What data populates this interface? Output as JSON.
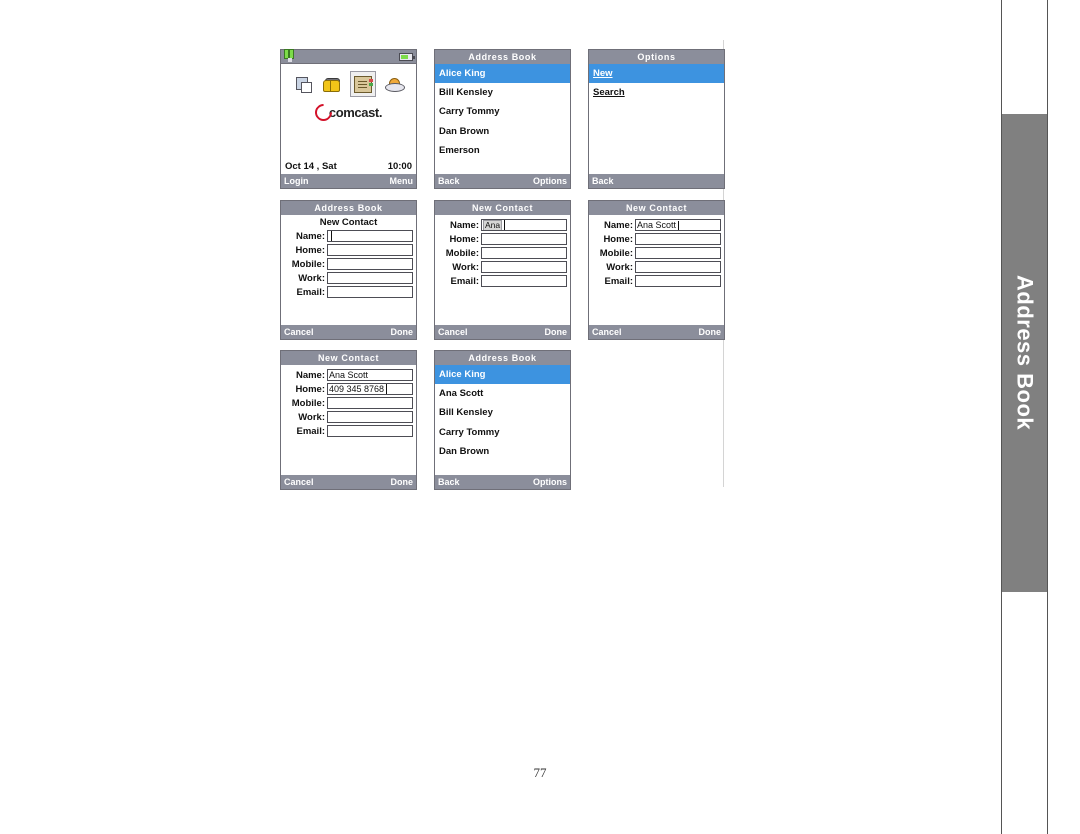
{
  "document": {
    "page_number": "77",
    "section_tab": "Address Book"
  },
  "screens": [
    {
      "id": "home",
      "type": "home",
      "statusbar": {
        "signal_icon": "signal-bars-icon",
        "battery_icon": "battery-icon"
      },
      "icons": [
        {
          "name": "device-messaging-icon",
          "selected": false
        },
        {
          "name": "open-book-icon",
          "selected": false
        },
        {
          "name": "address-book-icon",
          "selected": true
        },
        {
          "name": "weather-icon",
          "selected": false
        }
      ],
      "brand": "comcast.",
      "date": "Oct 14 , Sat",
      "time": "10:00",
      "softkeys": {
        "left": "Login",
        "right": "Menu"
      }
    },
    {
      "id": "address-book-list",
      "type": "list",
      "title": "Address Book",
      "items": [
        {
          "label": "Alice King",
          "selected": true,
          "underline": false
        },
        {
          "label": "Bill Kensley",
          "selected": false,
          "underline": false
        },
        {
          "label": "Carry Tommy",
          "selected": false,
          "underline": false
        },
        {
          "label": "Dan Brown",
          "selected": false,
          "underline": false
        },
        {
          "label": "Emerson",
          "selected": false,
          "underline": false
        }
      ],
      "softkeys": {
        "left": "Back",
        "right": "Options"
      }
    },
    {
      "id": "options-menu",
      "type": "list",
      "title": "Options",
      "items": [
        {
          "label": "New",
          "selected": true,
          "underline": true
        },
        {
          "label": "Search",
          "selected": false,
          "underline": true
        }
      ],
      "softkeys": {
        "left": "Back",
        "right": ""
      }
    },
    {
      "id": "new-contact-empty",
      "type": "form",
      "title": "Address Book",
      "subhead": "New Contact",
      "fields": [
        {
          "label": "Name:",
          "value": "",
          "caret": true,
          "ime": false
        },
        {
          "label": "Home:",
          "value": "",
          "caret": false,
          "ime": false
        },
        {
          "label": "Mobile:",
          "value": "",
          "caret": false,
          "ime": false
        },
        {
          "label": "Work:",
          "value": "",
          "caret": false,
          "ime": false
        },
        {
          "label": "Email:",
          "value": "",
          "caret": false,
          "ime": false
        }
      ],
      "softkeys": {
        "left": "Cancel",
        "right": "Done"
      }
    },
    {
      "id": "new-contact-typing-ana",
      "type": "form",
      "title": "New Contact",
      "subhead": "",
      "fields": [
        {
          "label": "Name:",
          "value": "Ana",
          "caret": true,
          "ime": true
        },
        {
          "label": "Home:",
          "value": "",
          "caret": false,
          "ime": false
        },
        {
          "label": "Mobile:",
          "value": "",
          "caret": false,
          "ime": false
        },
        {
          "label": "Work:",
          "value": "",
          "caret": false,
          "ime": false
        },
        {
          "label": "Email:",
          "value": "",
          "caret": false,
          "ime": false
        }
      ],
      "softkeys": {
        "left": "Cancel",
        "right": "Done"
      }
    },
    {
      "id": "new-contact-name-complete",
      "type": "form",
      "title": "New Contact",
      "subhead": "",
      "fields": [
        {
          "label": "Name:",
          "value": "Ana Scott",
          "caret": true,
          "ime": false
        },
        {
          "label": "Home:",
          "value": "",
          "caret": false,
          "ime": false
        },
        {
          "label": "Mobile:",
          "value": "",
          "caret": false,
          "ime": false
        },
        {
          "label": "Work:",
          "value": "",
          "caret": false,
          "ime": false
        },
        {
          "label": "Email:",
          "value": "",
          "caret": false,
          "ime": false
        }
      ],
      "softkeys": {
        "left": "Cancel",
        "right": "Done"
      }
    },
    {
      "id": "new-contact-home-number",
      "type": "form",
      "title": "New Contact",
      "subhead": "",
      "fields": [
        {
          "label": "Name:",
          "value": "Ana Scott",
          "caret": false,
          "ime": false
        },
        {
          "label": "Home:",
          "value": "409 345 8768",
          "caret": true,
          "ime": false
        },
        {
          "label": "Mobile:",
          "value": "",
          "caret": false,
          "ime": false
        },
        {
          "label": "Work:",
          "value": "",
          "caret": false,
          "ime": false
        },
        {
          "label": "Email:",
          "value": "",
          "caret": false,
          "ime": false
        }
      ],
      "softkeys": {
        "left": "Cancel",
        "right": "Done"
      }
    },
    {
      "id": "address-book-updated",
      "type": "list",
      "title": "Address Book",
      "items": [
        {
          "label": "Alice King",
          "selected": true,
          "underline": false
        },
        {
          "label": "Ana Scott",
          "selected": false,
          "underline": false
        },
        {
          "label": "Bill Kensley",
          "selected": false,
          "underline": false
        },
        {
          "label": "Carry Tommy",
          "selected": false,
          "underline": false
        },
        {
          "label": "Dan Brown",
          "selected": false,
          "underline": false
        }
      ],
      "softkeys": {
        "left": "Back",
        "right": "Options"
      }
    }
  ],
  "colors": {
    "title_bar": "#8b8e9b",
    "selection": "#3d93e0",
    "brand_red": "#d3122a",
    "tab_gray": "#808080"
  }
}
